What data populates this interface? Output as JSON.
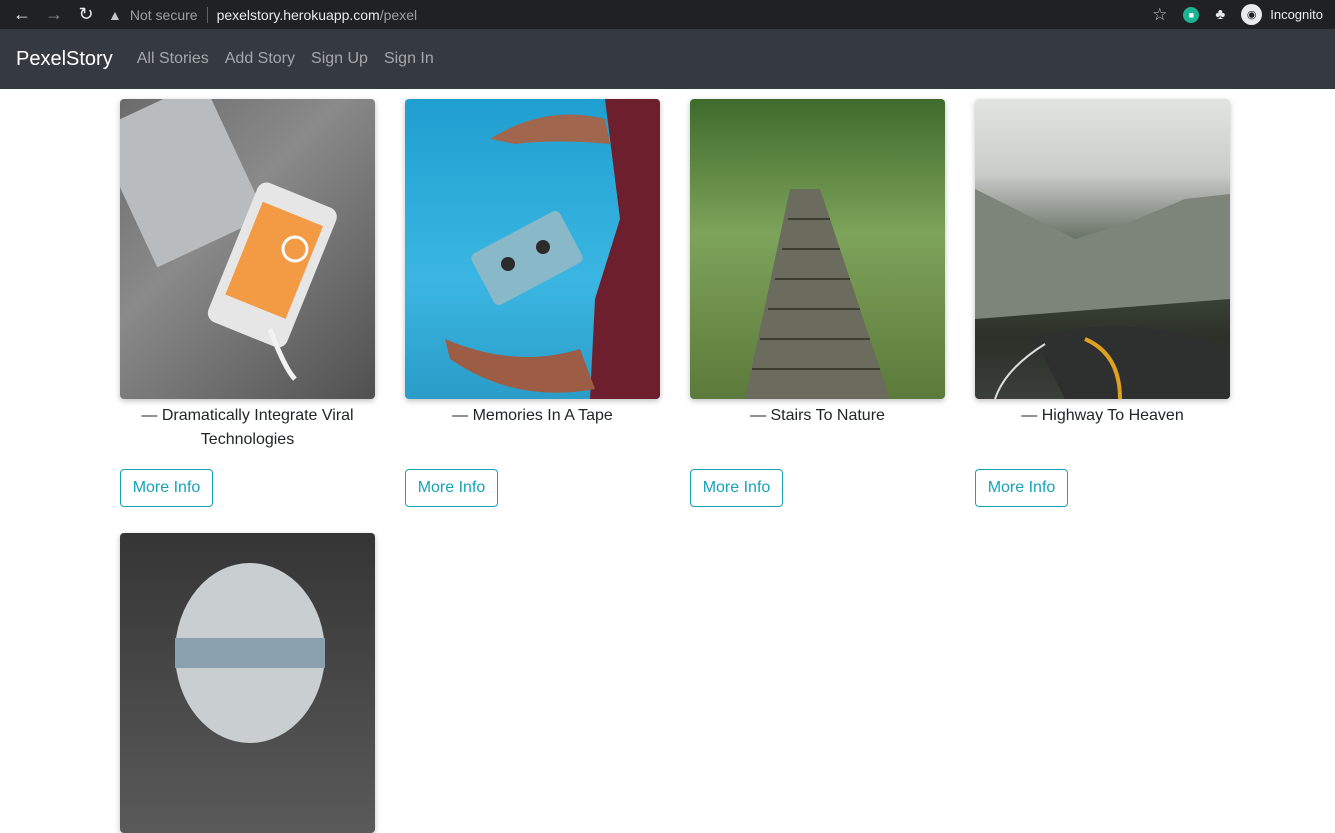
{
  "browser": {
    "security_label": "Not secure",
    "url_host": "pexelstory.herokuapp.com",
    "url_path": "/pexel",
    "profile_label": "Incognito"
  },
  "navbar": {
    "brand": "PexelStory",
    "links": [
      "All Stories",
      "Add Story",
      "Sign Up",
      "Sign In"
    ]
  },
  "stories": [
    {
      "caption": "— Dramatically Integrate Viral Technologies",
      "button": "More Info"
    },
    {
      "caption": "— Memories In A Tape",
      "button": "More Info"
    },
    {
      "caption": "— Stairs To Nature",
      "button": "More Info"
    },
    {
      "caption": "— Highway To Heaven",
      "button": "More Info"
    }
  ]
}
